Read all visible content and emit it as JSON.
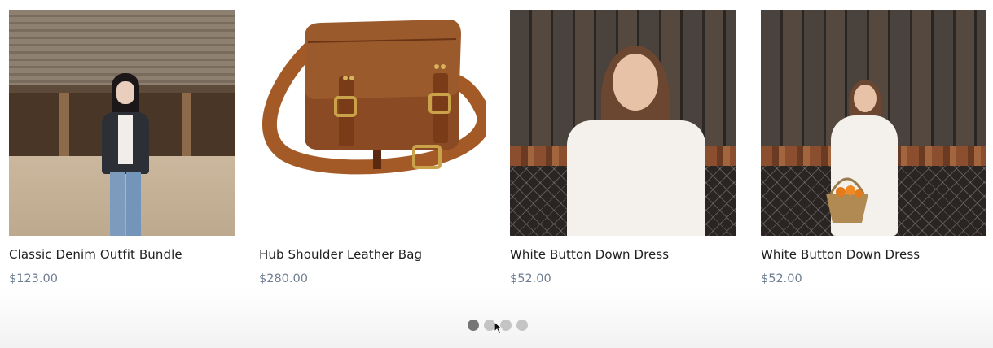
{
  "products": [
    {
      "title": "Classic Denim Outfit Bundle",
      "price": "$123.00",
      "image": "woman-in-denim-jacket-at-barn"
    },
    {
      "title": "Hub Shoulder Leather Bag",
      "price": "$280.00",
      "image": "brown-leather-shoulder-bag"
    },
    {
      "title": "White Button Down Dress",
      "price": "$52.00",
      "image": "woman-in-white-dress-closeup"
    },
    {
      "title": "White Button Down Dress",
      "price": "$52.00",
      "image": "woman-in-white-dress-with-basket"
    }
  ],
  "pagination": {
    "pages": 4,
    "active_index": 0
  },
  "colors": {
    "title": "#1f1f1f",
    "price": "#6e7e92",
    "dot_active": "#767676",
    "dot_inactive": "#c4c4c4"
  }
}
